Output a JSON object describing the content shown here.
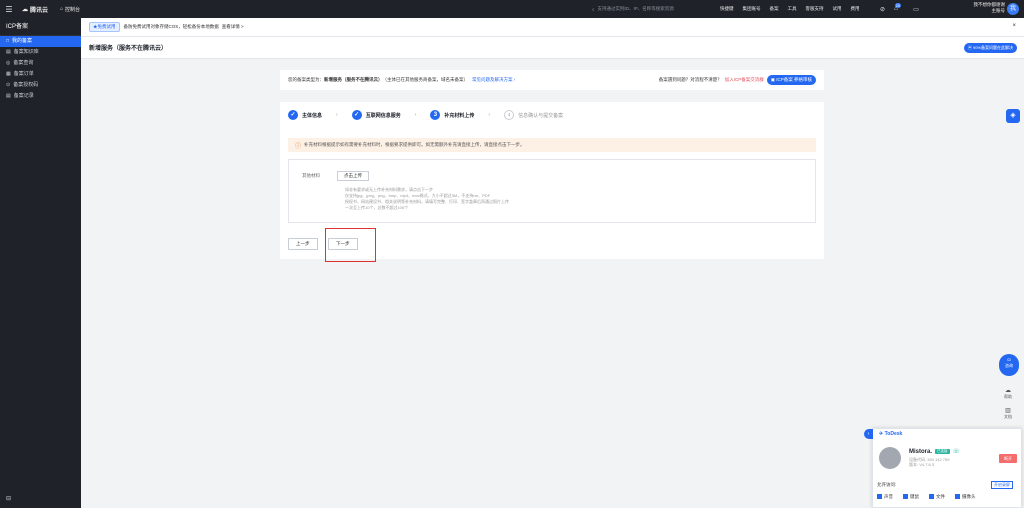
{
  "topbar": {
    "logo": "腾讯云",
    "console": "控制台",
    "search_placeholder": "支持通过实例ID、IP、名称等搜索资源",
    "links": [
      "快捷键",
      "集团账号",
      "备案",
      "工具",
      "客服支持",
      "试用",
      "费用"
    ],
    "msg_count": "20",
    "user_name": "我不想你都谢谢",
    "user_sub": "主账号",
    "avatar": "我"
  },
  "sidebar": {
    "title": "ICP备案",
    "items": [
      {
        "label": "我的备案",
        "icon": "□"
      },
      {
        "label": "备案知识库",
        "icon": "▤"
      },
      {
        "label": "备案查询",
        "icon": "◎"
      },
      {
        "label": "备案订单",
        "icon": "▦"
      },
      {
        "label": "备案授权码",
        "icon": "⊙"
      },
      {
        "label": "备案记录",
        "icon": "▤"
      }
    ],
    "bottom_icon": "⊟"
  },
  "notice": {
    "tag": "★免费试用",
    "text": "备防免费试用对象存储COS，轻松备份本地数据",
    "link": "查看详情 >",
    "close": "×"
  },
  "page": {
    "title": "新增服务（服务不在腾讯云）",
    "help": "90%备案问题在此解决"
  },
  "typebar": {
    "label": "您的备案类型为：",
    "type": "新增服务（服务不在腾讯云）",
    "desc": "（主体已在其他服务商备案，域名未备案）",
    "link": "常见问题及解决方案 ›",
    "q": "备案遇到问题？对流程不清楚？",
    "q_link": "加入ICP备案交流群",
    "btn": "ICP备案 养格审核"
  },
  "steps": [
    {
      "label": "主体信息",
      "state": "done",
      "num": "✓"
    },
    {
      "label": "互联网信息服务",
      "state": "done",
      "num": "✓"
    },
    {
      "label": "补充材料上传",
      "state": "active",
      "num": "3"
    },
    {
      "label": "信息确认与提交备案",
      "state": "todo",
      "num": "4"
    }
  ],
  "warning": "补充材料根据提示如有需要补充材料时，根据要求提供即可。如无需额外补充请直接上传，请直接点击下一步。",
  "form": {
    "label": "其他材料",
    "upload": "点击上传",
    "hints": [
      "如非有要求或无上传补充材料需求，请点击下一步",
      "仅支持jpg、jpeg、png、bmp、mp4、mov格式，大小不超过5M，不支持rar、PDF",
      "授权书、网站建设书、相关说明等补充材料，请填写完整、打印、签字盖章后再通过照片上传",
      "一次至上传10个，总数不超过100个"
    ]
  },
  "buttons": {
    "prev": "上一步",
    "next": "下一步"
  },
  "right_tools": {
    "float_icon": "◈",
    "consult": "咨询",
    "tools": [
      {
        "icon": "☁",
        "label": "帮助"
      },
      {
        "icon": "▥",
        "label": "文档"
      }
    ]
  },
  "todesk": {
    "brand": "ToDesk",
    "collapse": "›",
    "name": "Mistora.",
    "status": "已连接",
    "device": "设备代码: 394 142 759",
    "version": "版本: V4.7.6.3",
    "open": "断开",
    "allow": "允许访问:",
    "record": "开启录屏",
    "options": [
      "声音",
      "键鼠",
      "文件",
      "摄像头"
    ]
  }
}
